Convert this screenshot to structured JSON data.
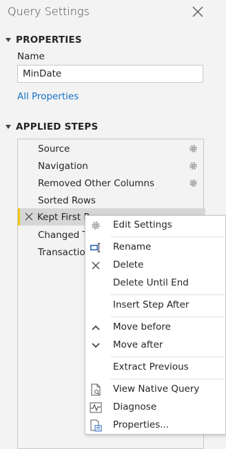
{
  "header": {
    "title": "Query Settings"
  },
  "properties": {
    "heading": "PROPERTIES",
    "name_label": "Name",
    "name_value": "MinDate",
    "all_properties_link": "All Properties"
  },
  "applied_steps": {
    "heading": "APPLIED STEPS",
    "steps": [
      {
        "label": "Source"
      },
      {
        "label": "Navigation"
      },
      {
        "label": "Removed Other Columns"
      },
      {
        "label": "Sorted Rows"
      },
      {
        "label": "Kept First R"
      },
      {
        "label": "Changed T"
      },
      {
        "label": "Transaction"
      }
    ]
  },
  "context_menu": {
    "items": {
      "edit_settings": "Edit Settings",
      "rename": "Rename",
      "delete": "Delete",
      "delete_until_end": "Delete Until End",
      "insert_step_after": "Insert Step After",
      "move_before": "Move before",
      "move_after": "Move after",
      "extract_previous": "Extract Previous",
      "view_native_query": "View Native Query",
      "diagnose": "Diagnose",
      "properties": "Properties..."
    }
  },
  "colors": {
    "accent": "#f2c811",
    "link": "#1570c6",
    "panel_bg": "#f3f3f3",
    "selected_bg": "#d6d6d6"
  }
}
